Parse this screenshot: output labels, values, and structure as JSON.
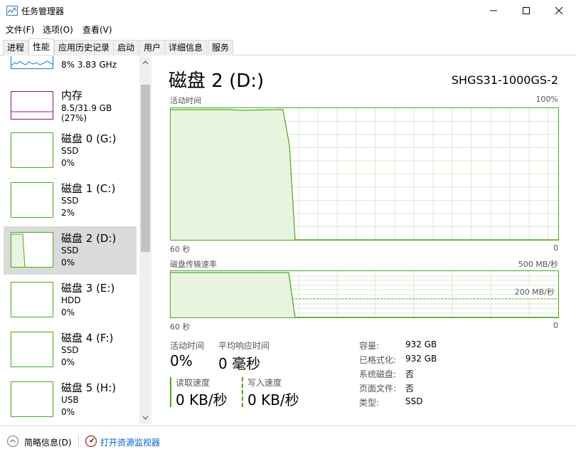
{
  "window": {
    "title": "任务管理器"
  },
  "menu": [
    "文件(F)",
    "选项(O)",
    "查看(V)"
  ],
  "tabs": [
    "进程",
    "性能",
    "应用历史记录",
    "启动",
    "用户",
    "详细信息",
    "服务"
  ],
  "sidebar": {
    "cpu": {
      "value": "8%  3.83 GHz"
    },
    "memory": {
      "name": "内存",
      "value": "8.5/31.9 GB (27%)"
    },
    "disks": [
      {
        "name": "磁盘 0 (G:)",
        "type": "SSD",
        "value": "0%"
      },
      {
        "name": "磁盘 1 (C:)",
        "type": "SSD",
        "value": "2%"
      },
      {
        "name": "磁盘 2 (D:)",
        "type": "SSD",
        "value": "0%"
      },
      {
        "name": "磁盘 3 (E:)",
        "type": "HDD",
        "value": "0%"
      },
      {
        "name": "磁盘 4 (F:)",
        "type": "SSD",
        "value": "0%"
      },
      {
        "name": "磁盘 5 (H:)",
        "type": "USB",
        "value": "0%"
      }
    ]
  },
  "main": {
    "title": "磁盘 2 (D:)",
    "model": "SHGS31-1000GS-2",
    "activity_graph": {
      "label": "活动时间",
      "max": "100%",
      "time": "60 秒",
      "min": "0"
    },
    "transfer_graph": {
      "label": "磁盘传输速率",
      "max": "500 MB/秒",
      "mid": "200 MB/秒",
      "time": "60 秒",
      "min": "0"
    },
    "stats": {
      "active_time_label": "活动时间",
      "active_time": "0%",
      "avg_response_label": "平均响应时间",
      "avg_response": "0 毫秒",
      "read_label": "读取速度",
      "read": "0 KB/秒",
      "write_label": "写入速度",
      "write": "0 KB/秒"
    },
    "info": [
      {
        "label": "容量:",
        "value": "932 GB"
      },
      {
        "label": "已格式化:",
        "value": "932 GB"
      },
      {
        "label": "系统磁盘:",
        "value": "否"
      },
      {
        "label": "页面文件:",
        "value": "否"
      },
      {
        "label": "类型:",
        "value": "SSD"
      }
    ]
  },
  "footer": {
    "brief": "简略信息(D)",
    "monitor": "打开资源监视器"
  },
  "colors": {
    "disk": "#4da71b",
    "memory": "#8b128b",
    "link": "#0066cc"
  }
}
